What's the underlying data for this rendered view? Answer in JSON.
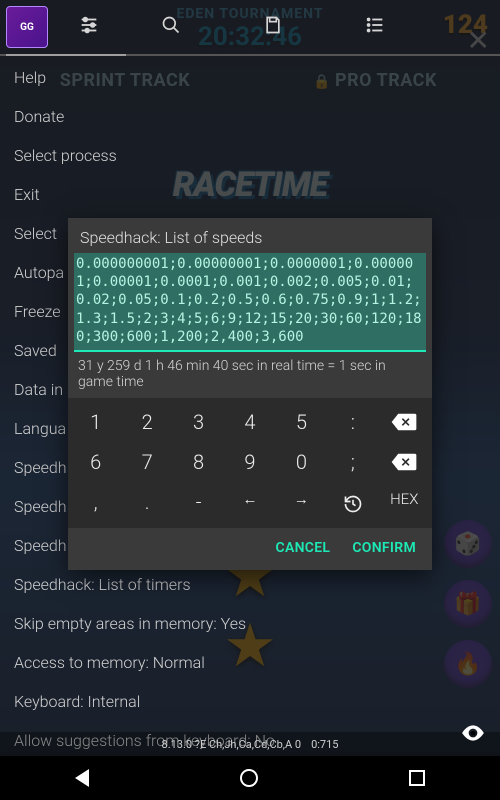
{
  "game": {
    "tournament_label": "EDEN TOURNAMENT",
    "clock": "20:32:46",
    "score": "124",
    "track_left": "SPRINT TRACK",
    "track_right": "PRO TRACK",
    "logo_text": "RACETIME"
  },
  "gg": {
    "menu": [
      "Help",
      "Donate",
      "Select process",
      "Exit",
      "Select",
      "Autopa",
      "Freeze",
      "Saved",
      "Data in",
      "Langua",
      "Speedh",
      "Speedh",
      "Speedh",
      "Speedhack: List of timers",
      "Skip empty areas in memory: Yes",
      "Access to memory: Normal",
      "Keyboard: Internal",
      "Allow suggestions from keyboard: No"
    ],
    "footer_left": "8.13.0  ?E  Ch,Jh,Ca,Cd,Cb,A 0",
    "footer_right": "0:715"
  },
  "dialog": {
    "title": "Speedhack: List of speeds",
    "input_value": "0.000000001;0.00000001;0.0000001;0.000001;0.00001;0.0001;0.001;0.002;0.005;0.01;0.02;0.05;0.1;0.2;0.5;0.6;0.75;0.9;1;1.2;1.3;1.5;2;3;4;5;6;9;12;15;20;30;60;120;180;300;600;1,200;2,400;3,600",
    "hint": "31 y 259 d 1 h 46 min 40 sec in real time = 1 sec in game time",
    "keys": {
      "r1": [
        "1",
        "2",
        "3",
        "4",
        "5",
        ":"
      ],
      "r2": [
        "6",
        "7",
        "8",
        "9",
        "0",
        ";"
      ],
      "r3": [
        ",",
        ".",
        "-",
        "←",
        "→"
      ],
      "hex": "HEX"
    },
    "cancel": "CANCEL",
    "confirm": "CONFIRM"
  }
}
